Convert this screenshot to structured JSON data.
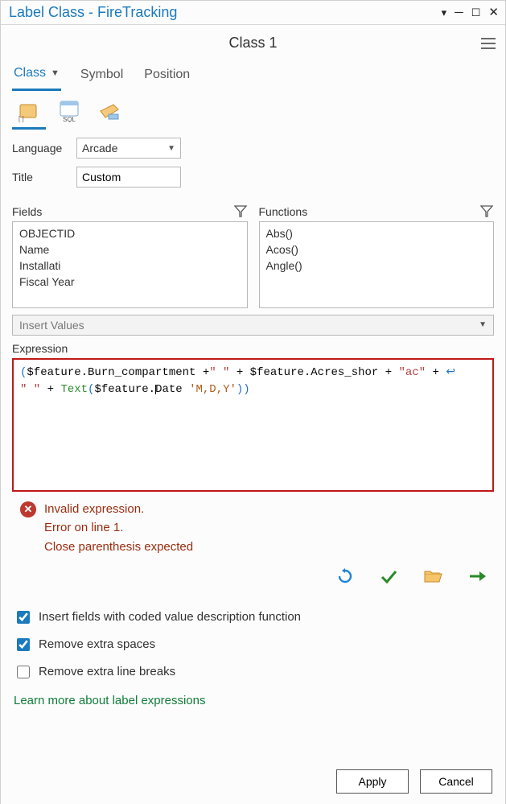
{
  "window": {
    "title": "Label Class - FireTracking"
  },
  "header": {
    "class_name": "Class 1"
  },
  "tabs": {
    "class": "Class",
    "symbol": "Symbol",
    "position": "Position"
  },
  "form": {
    "language_label": "Language",
    "language_value": "Arcade",
    "title_label": "Title",
    "title_value": "Custom"
  },
  "fields": {
    "label": "Fields",
    "items": [
      "OBJECTID",
      "Name",
      "Installati",
      "Fiscal Year"
    ]
  },
  "functions": {
    "label": "Functions",
    "items": [
      "Abs()",
      "Acos()",
      "Angle()"
    ]
  },
  "insert_values": "Insert Values",
  "expression": {
    "label": "Expression",
    "tokens": {
      "p1": "(",
      "t1": "$feature.Burn_compartment +",
      "s1": "\" \"",
      "t2": " + $feature.Acres_shor + ",
      "s2": "\"ac\"",
      "t3": " + ",
      "wrap": "↩",
      "s3": "\" \"",
      "t4": " + ",
      "fn": "Text",
      "p2": "(",
      "t5": "$feature.",
      "t6": "Date ",
      "sq": "'M,D,Y'",
      "p3": "))"
    }
  },
  "error": {
    "line1": "Invalid expression.",
    "line2": "Error on line 1.",
    "line3": "Close parenthesis expected"
  },
  "checks": {
    "coded": "Insert fields with coded value description function",
    "spaces": "Remove extra spaces",
    "breaks": "Remove extra line breaks"
  },
  "learn": "Learn more about label expressions",
  "footer": {
    "apply": "Apply",
    "cancel": "Cancel"
  }
}
